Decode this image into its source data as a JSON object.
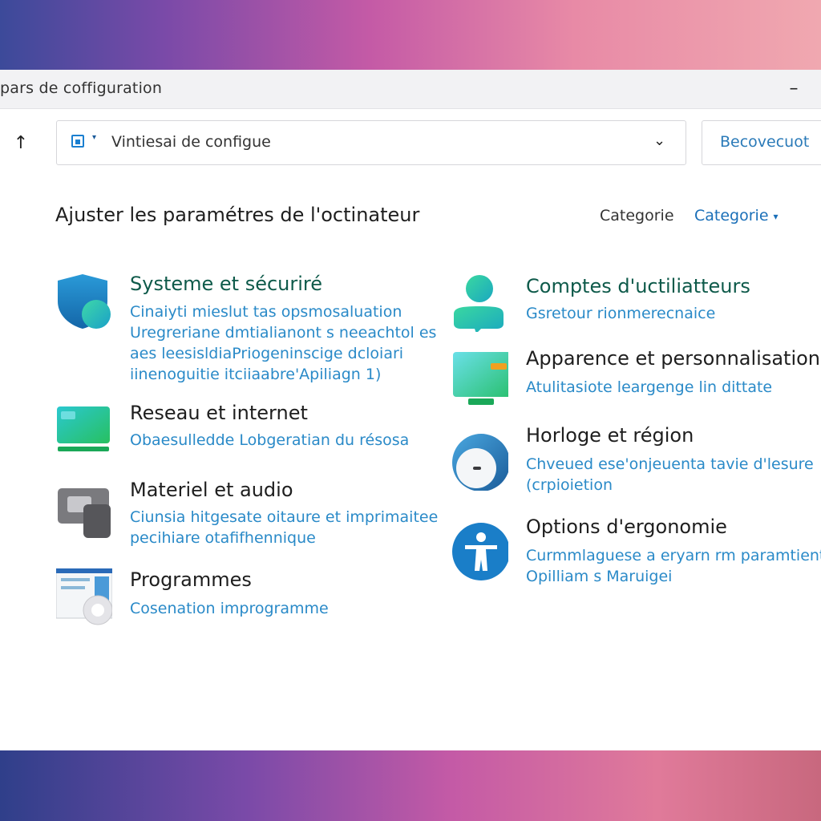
{
  "window": {
    "title": "pars de coffiguration",
    "minimize_glyph": "–"
  },
  "nav": {
    "up_glyph": "↑"
  },
  "address": {
    "path": "Vintiesai de configue",
    "chevron": "⌄"
  },
  "search": {
    "placeholder": "Becovecuot"
  },
  "main": {
    "heading": "Ajuster les paramétres de l'octinateur",
    "view_by_label": "Categorie",
    "view_by_value": "Categorie",
    "view_by_caret": "▾"
  },
  "colors": {
    "title_green": "#0e5a4a",
    "title_black": "#1e1e1e",
    "link_blue": "#2a8ac8",
    "accent_blue": "#1a6fb8"
  },
  "categories_left": [
    {
      "icon": "shield-icon",
      "title": "Systeme et sécuriré",
      "lines": [
        "Cinaiyti mieslut tas opsmosaluation",
        "Uregreriane dmtialianont s neeachtol es",
        "aes leesisldiaPriogeninscige dcloiari",
        "iinenoguitie itciiaabre'Apiliagn 1)"
      ]
    },
    {
      "icon": "network-monitor-icon",
      "title": "Reseau et internet",
      "lines": [
        "Obaesulledde Lobgeratian du résosa"
      ]
    },
    {
      "icon": "hardware-audio-icon",
      "title": "Materiel et audio",
      "lines": [
        "Ciunsia hitgesate oitaure et imprimaitee",
        "pecihiare otafifhennique"
      ]
    },
    {
      "icon": "programs-icon",
      "title": "Programmes",
      "lines": [
        "Cosenation improgramme"
      ]
    }
  ],
  "categories_right": [
    {
      "icon": "user-accounts-icon",
      "title": "Comptes d'uctiliatteurs",
      "lines": [
        "Gsretour rionmerecnaice"
      ]
    },
    {
      "icon": "appearance-monitor-icon",
      "title": "Apparence et personnalisation",
      "lines": [
        "Atulitasiote leargenge lin dittate"
      ]
    },
    {
      "icon": "clock-region-icon",
      "title": "Horloge et région",
      "lines": [
        "Chveued ese'onjeuenta tavie d'lesure",
        "(crpioietion"
      ]
    },
    {
      "icon": "accessibility-icon",
      "title": "Options d'ergonomie",
      "lines": [
        "Curmmlaguese a eryarn rm paramtient",
        "Opilliam s Maruigei"
      ]
    }
  ]
}
